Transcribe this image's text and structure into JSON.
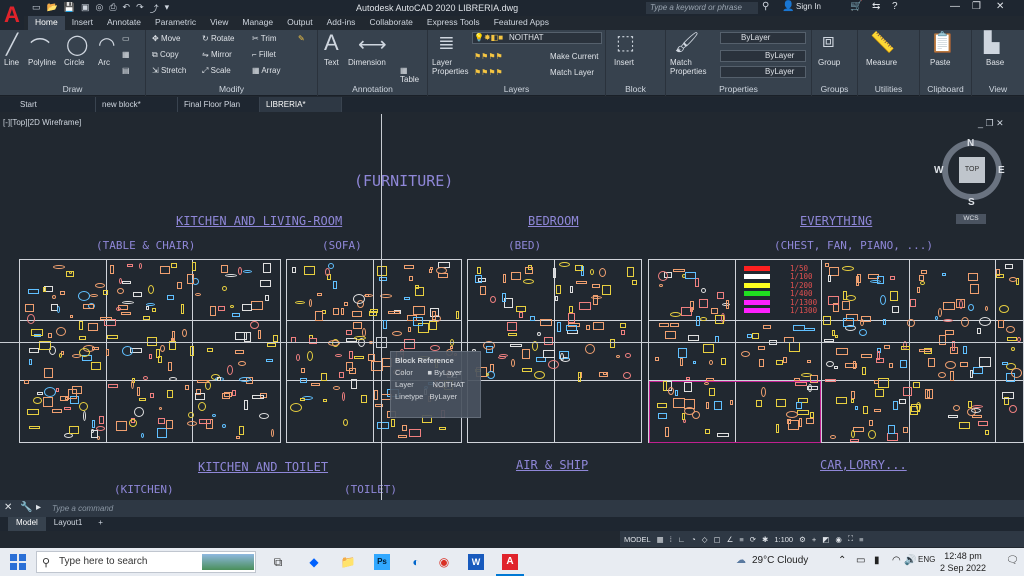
{
  "app": {
    "title": "Autodesk AutoCAD 2020   LIBRERIA.dwg",
    "logo": "A",
    "search_placeholder": "Type a keyword or phrase",
    "sign_in": "Sign In"
  },
  "ribbon_tabs": [
    "Home",
    "Insert",
    "Annotate",
    "Parametric",
    "View",
    "Manage",
    "Output",
    "Add-ins",
    "Collaborate",
    "Express Tools",
    "Featured Apps"
  ],
  "panels": {
    "draw": {
      "title": "Draw",
      "line": "Line",
      "polyline": "Polyline",
      "circle": "Circle",
      "arc": "Arc"
    },
    "modify": {
      "title": "Modify",
      "move": "Move",
      "rotate": "Rotate",
      "trim": "Trim",
      "copy": "Copy",
      "mirror": "Mirror",
      "fillet": "Fillet",
      "stretch": "Stretch",
      "scale": "Scale",
      "array": "Array"
    },
    "annotation": {
      "title": "Annotation",
      "text": "Text",
      "dimension": "Dimension",
      "table": "Table"
    },
    "layers": {
      "title": "Layers",
      "layer_properties": "Layer Properties",
      "current_layer": "NOITHAT",
      "make_current": "Make Current",
      "match_layer": "Match Layer"
    },
    "block": {
      "title": "Block",
      "insert": "Insert"
    },
    "properties": {
      "title": "Properties",
      "match": "Match Properties",
      "color": "ByLayer",
      "linetype": "ByLayer",
      "lineweight": "ByLayer"
    },
    "groups": {
      "title": "Groups",
      "group": "Group"
    },
    "utilities": {
      "title": "Utilities",
      "measure": "Measure"
    },
    "clipboard": {
      "title": "Clipboard",
      "paste": "Paste"
    },
    "view": {
      "title": "View",
      "base": "Base"
    }
  },
  "doc_tabs": [
    "Start",
    "new block*",
    "Final Floor Plan",
    "LIBRERIA*"
  ],
  "viewport": {
    "label": "[-][Top][2D Wireframe]",
    "main_title": "(FURNITURE)",
    "headings": {
      "kitchen_living": "KITCHEN AND LIVING-ROOM",
      "bedroom": "BEDROOM",
      "everything": "EVERYTHING",
      "kitchen_toilet": "KITCHEN AND TOILET",
      "air_ship": "AIR & SHIP",
      "car_lorry": "CAR,LORRY..."
    },
    "subs": {
      "table_chair": "(TABLE & CHAIR)",
      "sofa": "(SOFA)",
      "bed": "(BED)",
      "chest": "(CHEST, FAN, PIANO, ...)",
      "kitchen": "(KITCHEN)",
      "toilet": "(TOILET)"
    },
    "scales": [
      "1/50",
      "1/100",
      "1/200",
      "1/400",
      "1/1300",
      "1/1300"
    ],
    "scale_colors": [
      "#ff2020",
      "#ffffff",
      "#ffff20",
      "#20e020",
      "#ff20ff",
      "#ff20ff"
    ]
  },
  "tooltip": {
    "title": "Block Reference",
    "rows": [
      {
        "key": "Color",
        "value": "ByLayer"
      },
      {
        "key": "Layer",
        "value": "NOITHAT"
      },
      {
        "key": "Linetype",
        "value": "ByLayer"
      }
    ]
  },
  "navcube": {
    "n": "N",
    "s": "S",
    "e": "E",
    "w": "W",
    "top": "TOP",
    "wcs": "WCS"
  },
  "command": {
    "placeholder": "Type a command"
  },
  "layout_tabs": [
    "Model",
    "Layout1",
    "+"
  ],
  "status": {
    "model": "MODEL",
    "scale": "1:100"
  },
  "taskbar": {
    "search": "Type here to search",
    "weather": "29°C  Cloudy",
    "lang": "ENG",
    "time": "12:48 pm",
    "date": "2 Sep 2022"
  }
}
